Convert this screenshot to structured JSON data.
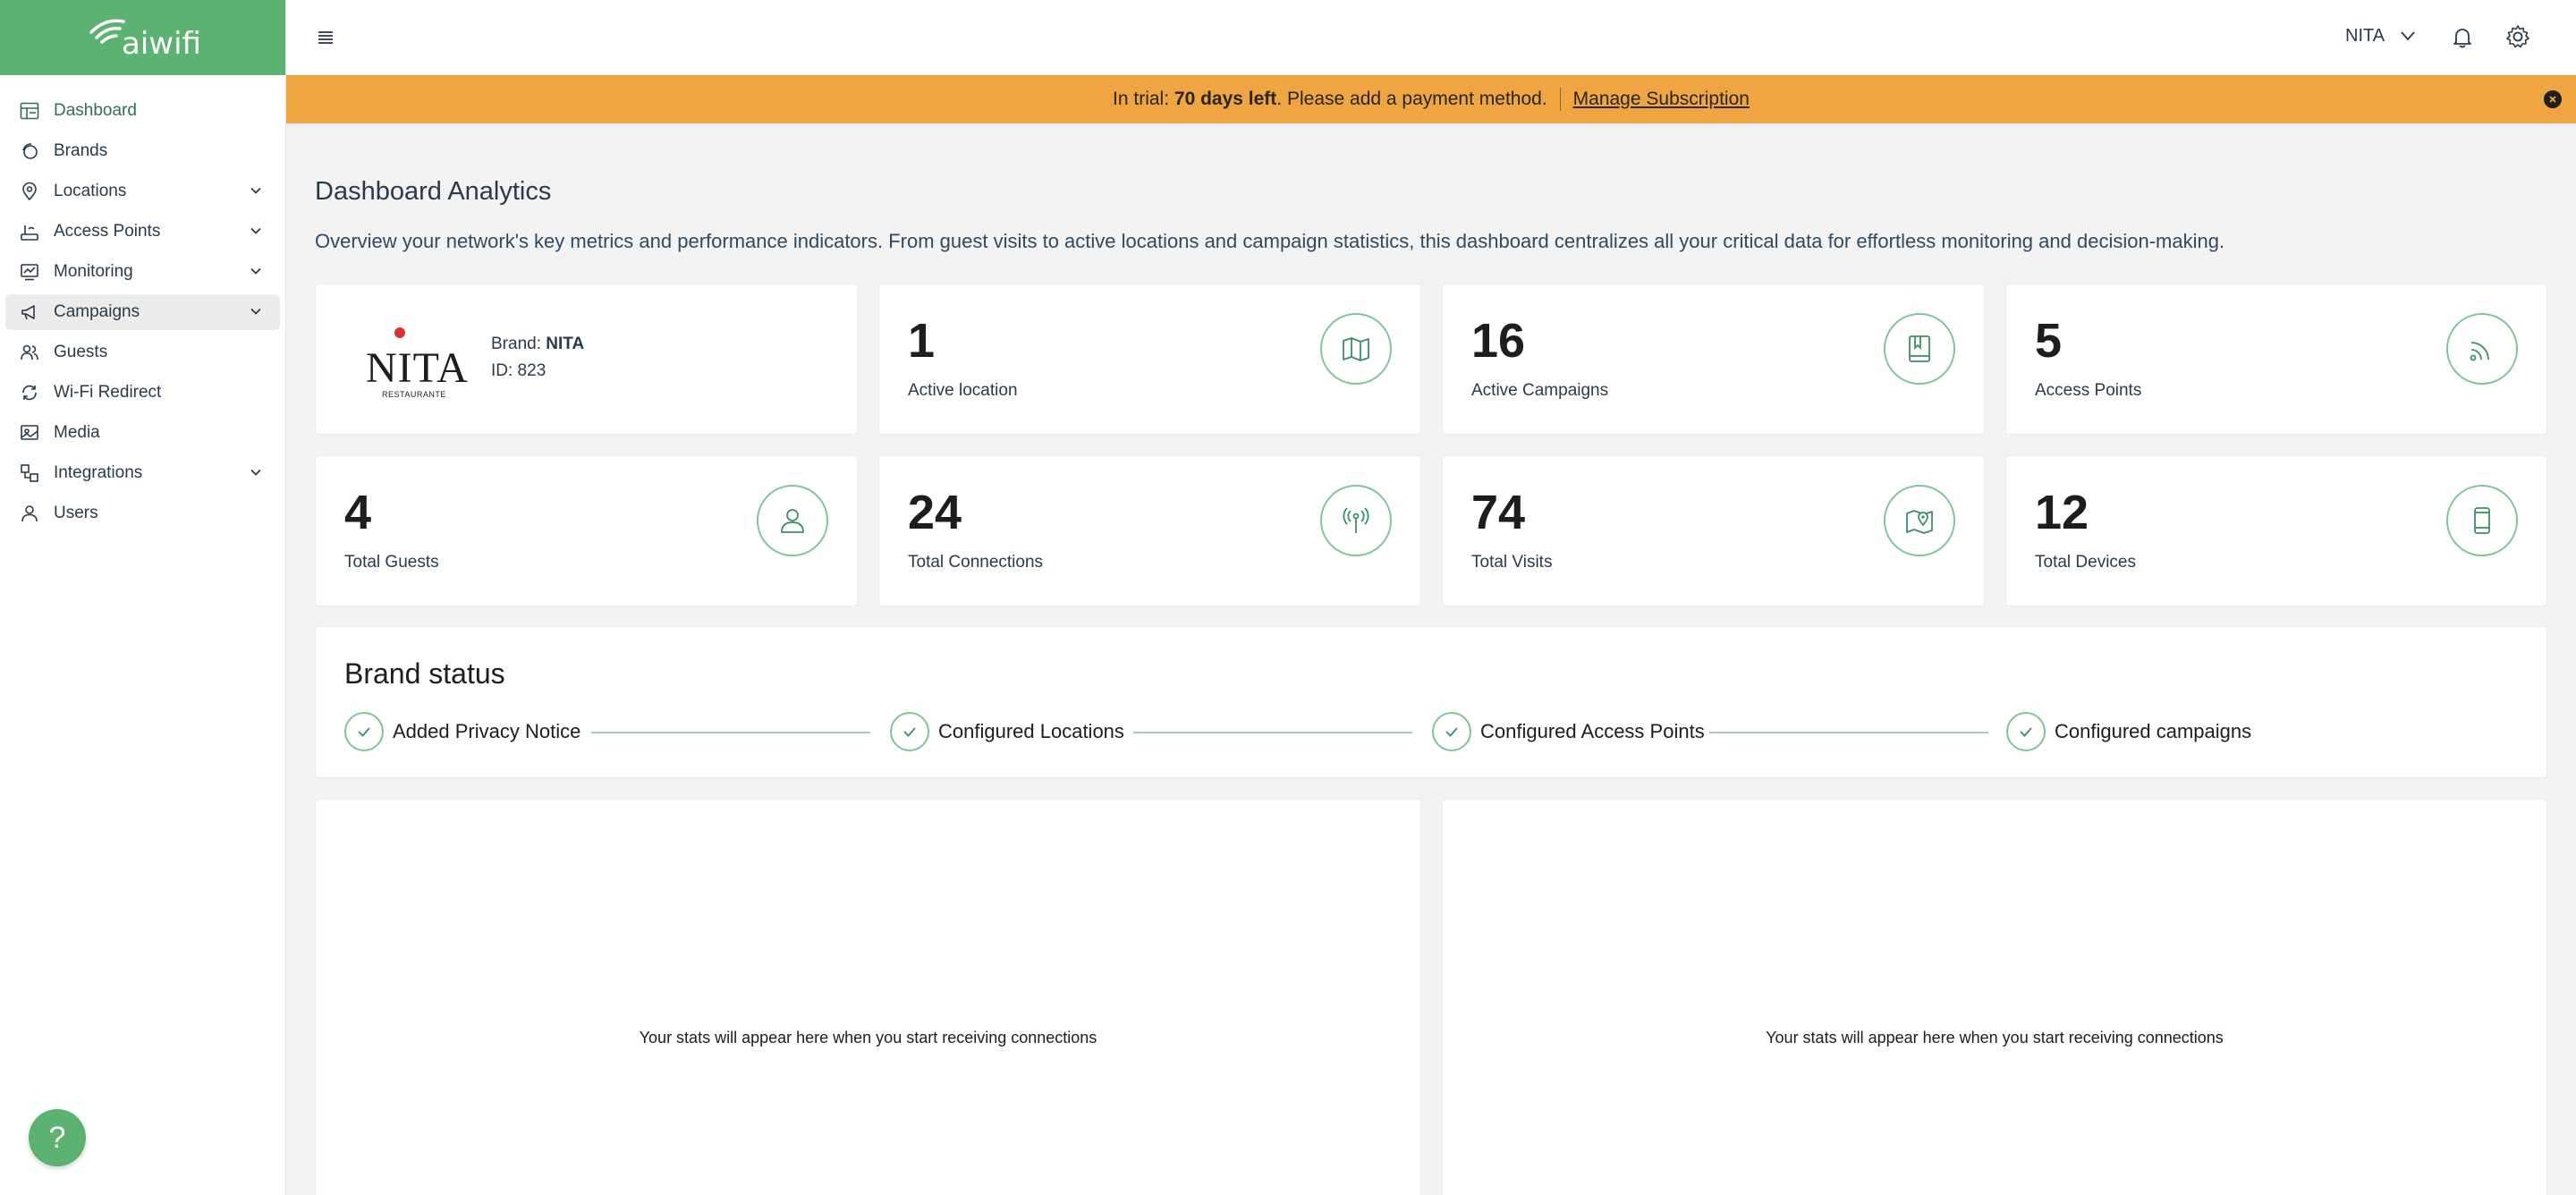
{
  "app": {
    "logo_text": "aiwifi",
    "brand_color": "#5cb270",
    "accent_color": "#f0a543"
  },
  "sidebar": {
    "items": [
      {
        "label": "Dashboard",
        "icon": "dashboard-icon",
        "has_submenu": false,
        "active": true
      },
      {
        "label": "Brands",
        "icon": "brands-icon",
        "has_submenu": false
      },
      {
        "label": "Locations",
        "icon": "location-pin-icon",
        "has_submenu": true
      },
      {
        "label": "Access Points",
        "icon": "router-icon",
        "has_submenu": true
      },
      {
        "label": "Monitoring",
        "icon": "monitoring-icon",
        "has_submenu": true
      },
      {
        "label": "Campaigns",
        "icon": "megaphone-icon",
        "has_submenu": true,
        "highlighted": true
      },
      {
        "label": "Guests",
        "icon": "guests-icon",
        "has_submenu": false
      },
      {
        "label": "Wi-Fi Redirect",
        "icon": "redirect-icon",
        "has_submenu": false
      },
      {
        "label": "Media",
        "icon": "media-icon",
        "has_submenu": false
      },
      {
        "label": "Integrations",
        "icon": "integrations-icon",
        "has_submenu": true
      },
      {
        "label": "Users",
        "icon": "user-icon",
        "has_submenu": false
      }
    ]
  },
  "topbar": {
    "user_name": "NITA",
    "icons": [
      "menu-icon",
      "chevron-down-icon",
      "bell-icon",
      "gear-icon"
    ]
  },
  "banner": {
    "prefix": "In trial: ",
    "days": "70 days left",
    "suffix": ". Please add a payment method.",
    "link": "Manage Subscription"
  },
  "main": {
    "title": "Dashboard Analytics",
    "description": "Overview your network's key metrics and performance indicators. From guest visits to active locations and campaign statistics, this dashboard centralizes all your critical data for effortless monitoring and decision-making."
  },
  "brand_card": {
    "logo_text": "NITA",
    "logo_sub": "RESTAURANTE",
    "brand_label": "Brand: ",
    "brand_name": "NITA",
    "id_text": "ID: 823"
  },
  "stats": [
    {
      "value": "1",
      "label": "Active location",
      "icon": "map-icon"
    },
    {
      "value": "16",
      "label": "Active Campaigns",
      "icon": "book-icon"
    },
    {
      "value": "5",
      "label": "Access Points",
      "icon": "wifi-signal-icon"
    },
    {
      "value": "4",
      "label": "Total Guests",
      "icon": "guest-icon"
    },
    {
      "value": "24",
      "label": "Total Connections",
      "icon": "antenna-icon"
    },
    {
      "value": "74",
      "label": "Total Visits",
      "icon": "map-pin-icon"
    },
    {
      "value": "12",
      "label": "Total Devices",
      "icon": "phone-icon"
    }
  ],
  "brand_status": {
    "title": "Brand status",
    "steps": [
      "Added Privacy Notice",
      "Configured Locations",
      "Configured Access Points",
      "Configured campaigns"
    ]
  },
  "panels": {
    "left_message": "Your stats will appear here when you start receiving connections",
    "right_message": "Your stats will appear here when you start receiving connections"
  },
  "help": {
    "label": "?"
  }
}
